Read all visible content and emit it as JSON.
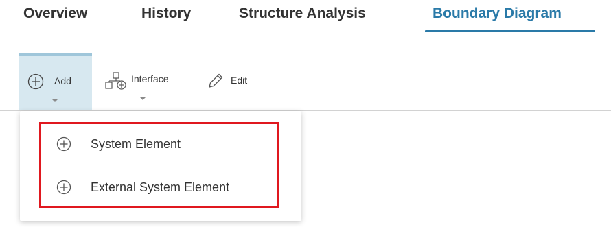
{
  "tabs": [
    {
      "label": "Overview"
    },
    {
      "label": "History"
    },
    {
      "label": "Structure Analysis"
    },
    {
      "label": "Boundary Diagram",
      "active": true
    }
  ],
  "toolbar": {
    "add_label": "Add",
    "interface_label": "Interface",
    "edit_label": "Edit"
  },
  "add_menu": {
    "items": [
      {
        "label": "System Element",
        "icon": "plus-circle-icon"
      },
      {
        "label": "External System Element",
        "icon": "plus-circle-icon"
      }
    ]
  },
  "colors": {
    "active_tab": "#2a7aa8",
    "add_button_bg": "#d7e8f0",
    "highlight_border": "#e0181f"
  }
}
